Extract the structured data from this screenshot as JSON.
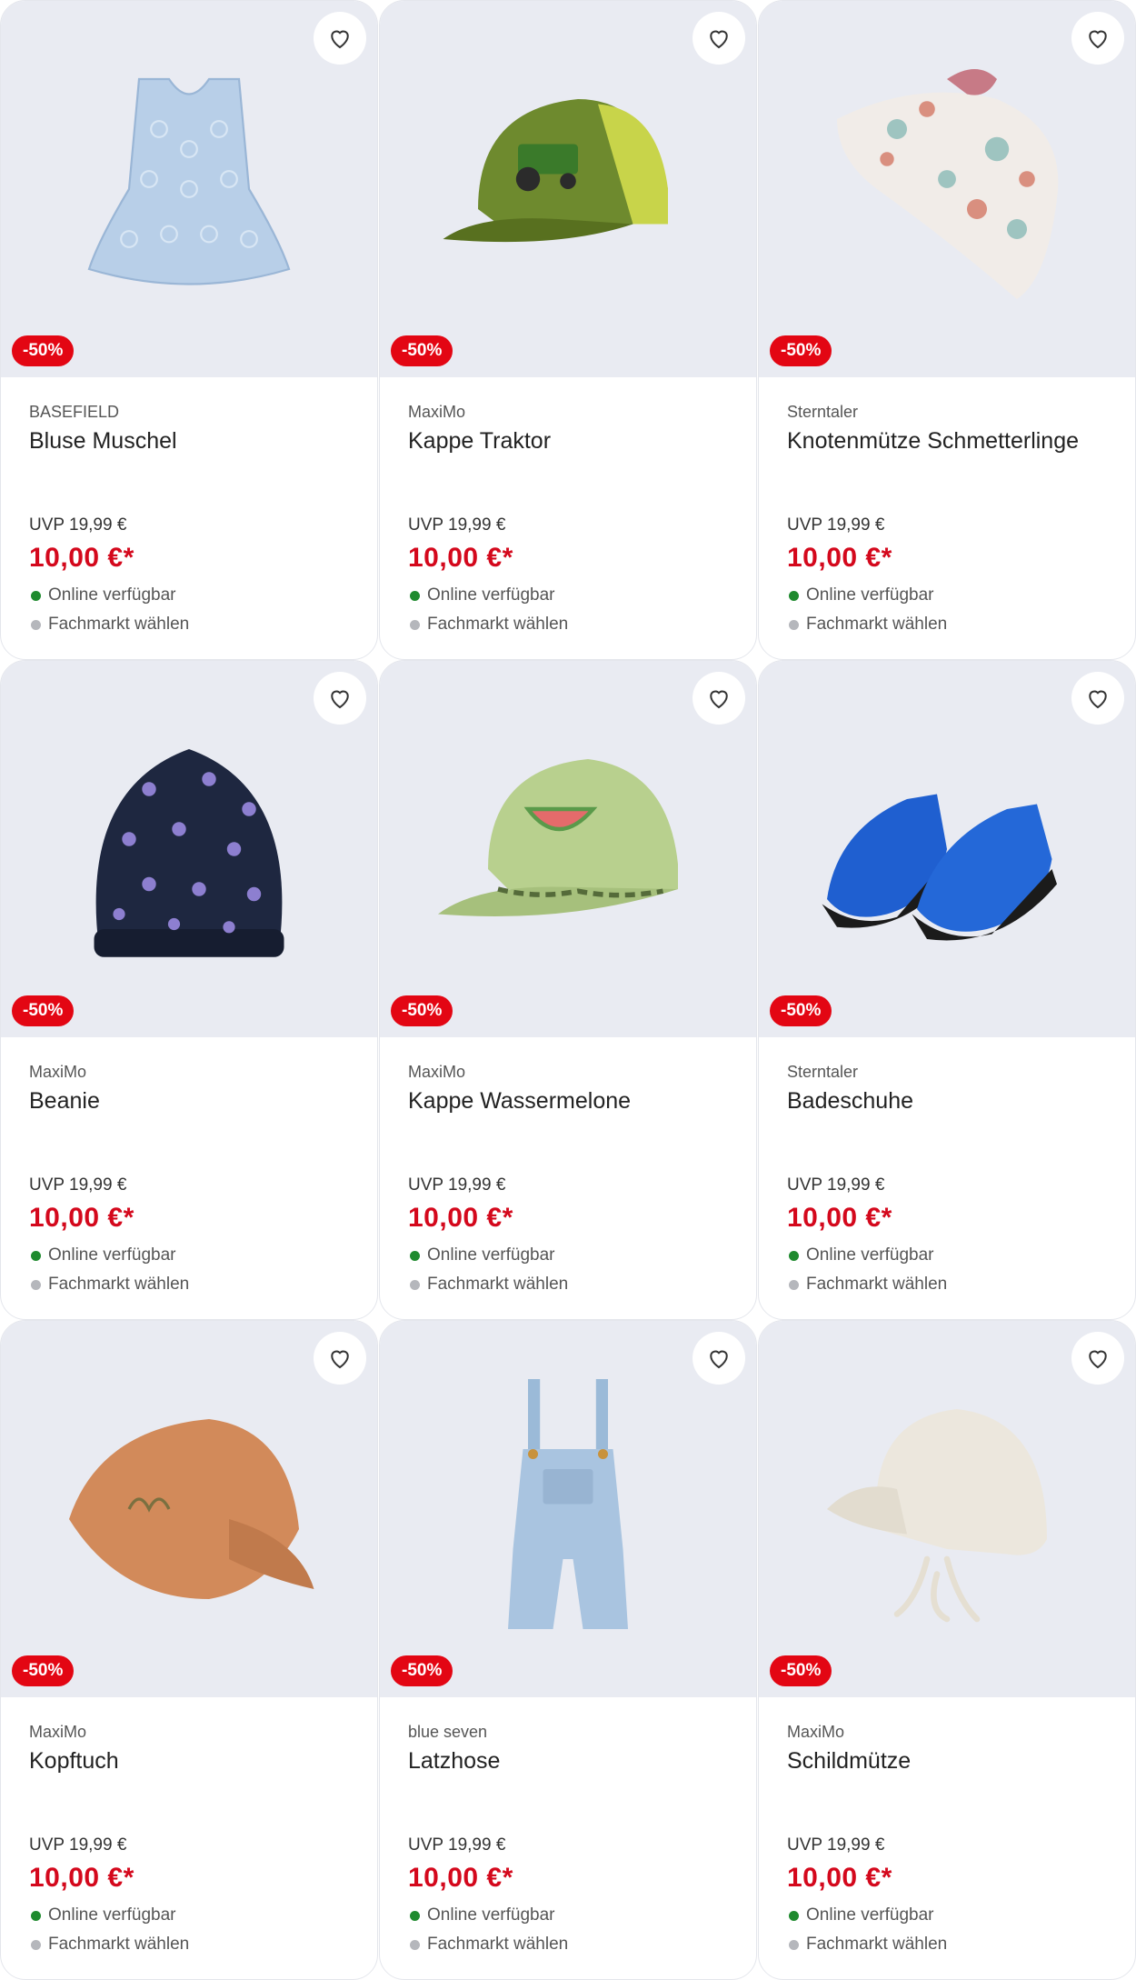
{
  "products": [
    {
      "brand": "BASEFIELD",
      "name": "Bluse Muschel",
      "badge": "-50%",
      "uvp": "UVP 19,99 €",
      "price": "10,00 €*",
      "online": "Online verfügbar",
      "store": "Fachmarkt wählen",
      "image": "blouse"
    },
    {
      "brand": "MaxiMo",
      "name": "Kappe Traktor",
      "badge": "-50%",
      "uvp": "UVP 19,99 €",
      "price": "10,00 €*",
      "online": "Online verfügbar",
      "store": "Fachmarkt wählen",
      "image": "cap-tractor"
    },
    {
      "brand": "Sterntaler",
      "name": "Knotenmütze Schmetterlinge",
      "badge": "-50%",
      "uvp": "UVP 19,99 €",
      "price": "10,00 €*",
      "online": "Online verfügbar",
      "store": "Fachmarkt wählen",
      "image": "knot-hat"
    },
    {
      "brand": "MaxiMo",
      "name": "Beanie",
      "badge": "-50%",
      "uvp": "UVP 19,99 €",
      "price": "10,00 €*",
      "online": "Online verfügbar",
      "store": "Fachmarkt wählen",
      "image": "beanie"
    },
    {
      "brand": "MaxiMo",
      "name": "Kappe Wassermelone",
      "badge": "-50%",
      "uvp": "UVP 19,99 €",
      "price": "10,00 €*",
      "online": "Online verfügbar",
      "store": "Fachmarkt wählen",
      "image": "cap-melon"
    },
    {
      "brand": "Sterntaler",
      "name": "Badeschuhe",
      "badge": "-50%",
      "uvp": "UVP 19,99 €",
      "price": "10,00 €*",
      "online": "Online verfügbar",
      "store": "Fachmarkt wählen",
      "image": "swim-shoes"
    },
    {
      "brand": "MaxiMo",
      "name": "Kopftuch",
      "badge": "-50%",
      "uvp": "UVP 19,99 €",
      "price": "10,00 €*",
      "online": "Online verfügbar",
      "store": "Fachmarkt wählen",
      "image": "headscarf"
    },
    {
      "brand": "blue seven",
      "name": "Latzhose",
      "badge": "-50%",
      "uvp": "UVP 19,99 €",
      "price": "10,00 €*",
      "online": "Online verfügbar",
      "store": "Fachmarkt wählen",
      "image": "overalls"
    },
    {
      "brand": "MaxiMo",
      "name": "Schildmütze",
      "badge": "-50%",
      "uvp": "UVP 19,99 €",
      "price": "10,00 €*",
      "online": "Online verfügbar",
      "store": "Fachmarkt wählen",
      "image": "sun-hat"
    }
  ],
  "colors": {
    "accent": "#e30613",
    "price": "#d4081c",
    "online_dot": "#1e8a2e",
    "store_dot": "#b5b7bc",
    "image_bg": "#e9ebf2"
  },
  "icons": {
    "favorite": "heart-outline-icon"
  }
}
